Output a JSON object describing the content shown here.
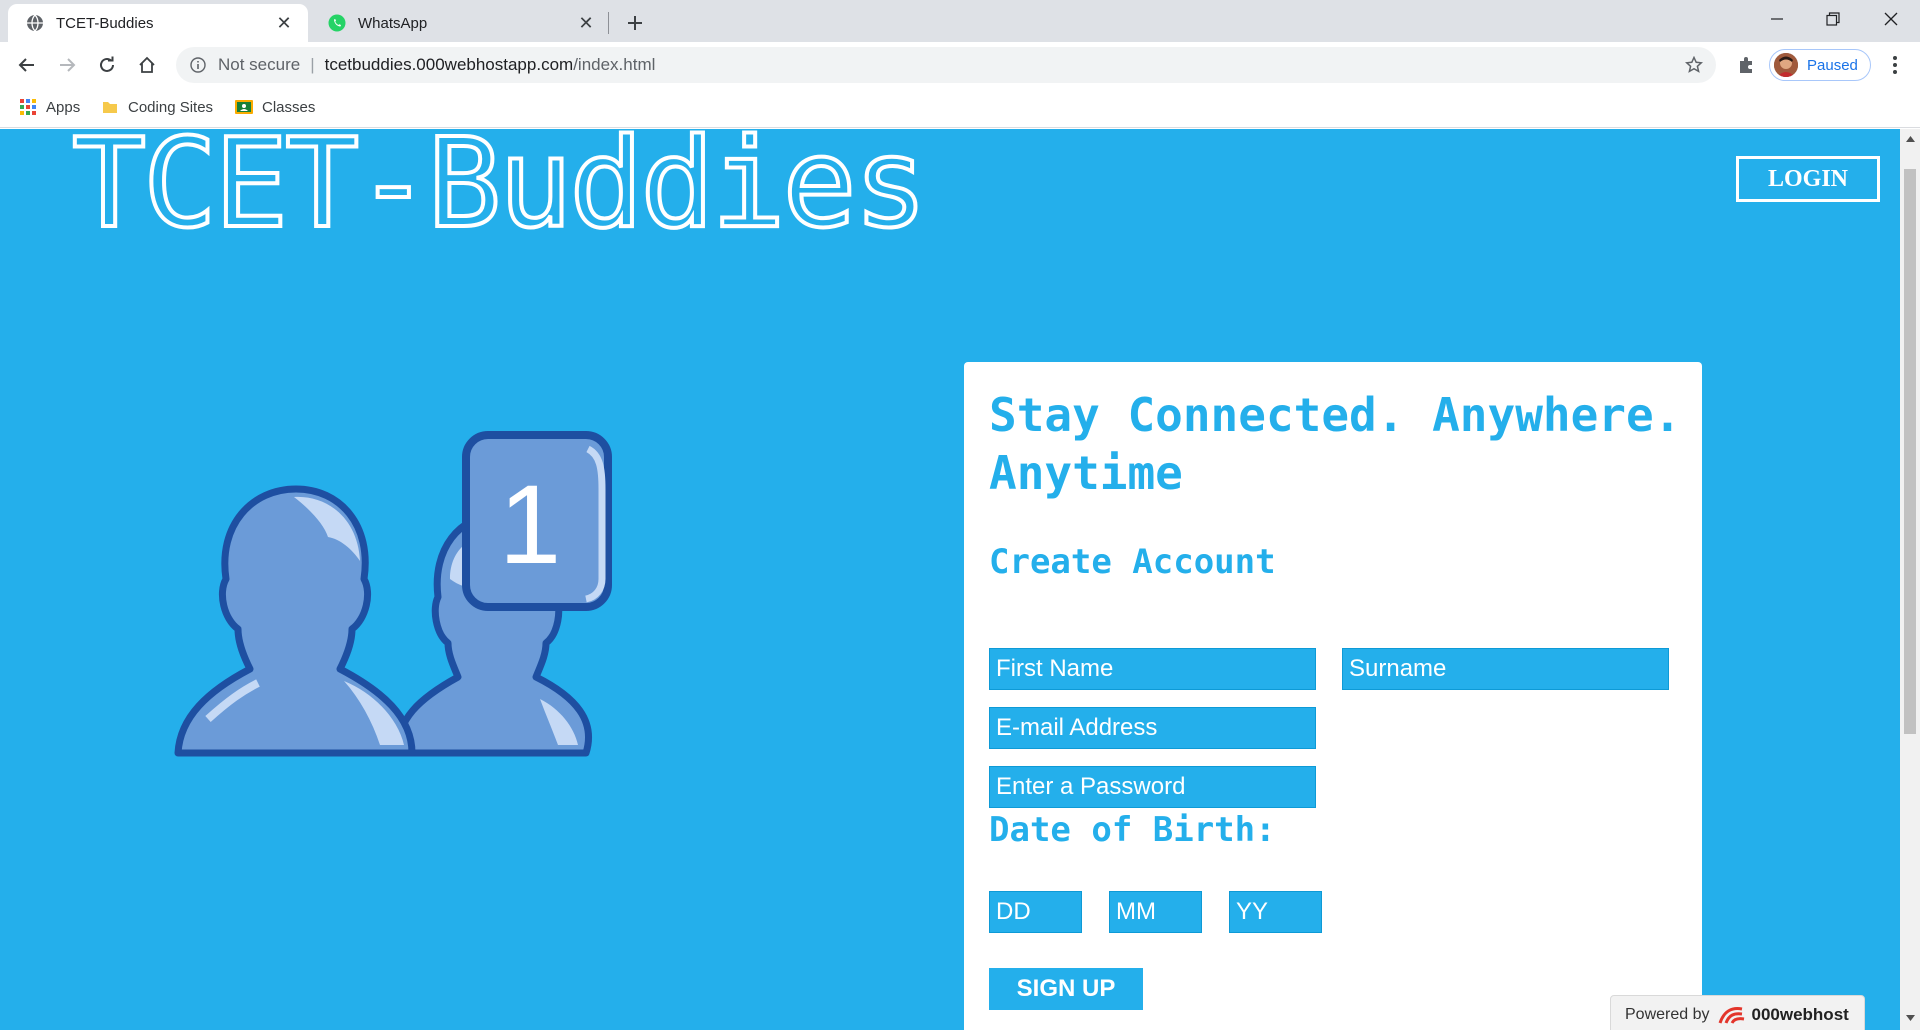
{
  "browser": {
    "tabs": [
      {
        "title": "TCET-Buddies",
        "icon": "globe-icon",
        "active": true
      },
      {
        "title": "WhatsApp",
        "icon": "whatsapp-icon",
        "active": false
      }
    ],
    "address": {
      "security_label": "Not secure",
      "separator": "|",
      "host": "tcetbuddies.000webhostapp.com",
      "path": "/index.html"
    },
    "profile": {
      "status": "Paused"
    },
    "bookmarks": [
      {
        "label": "Apps",
        "icon": "apps-grid-icon"
      },
      {
        "label": "Coding Sites",
        "icon": "folder-icon"
      },
      {
        "label": "Classes",
        "icon": "google-classroom-icon"
      }
    ]
  },
  "page": {
    "brand_title": "TCET-Buddies",
    "login_label": "LOGIN",
    "illustration": {
      "badge_number": "1",
      "icon": "friends-notification-icon"
    },
    "signup": {
      "tagline": "Stay Connected. Anywhere. Anytime",
      "heading": "Create Account",
      "first_name_placeholder": "First Name",
      "surname_placeholder": "Surname",
      "email_placeholder": "E-mail Address",
      "password_placeholder": "Enter a Password",
      "dob_label": "Date of Birth:",
      "dob_day_placeholder": "DD",
      "dob_month_placeholder": "MM",
      "dob_year_placeholder": "YY",
      "submit_label": "SIGN UP"
    },
    "host_badge": {
      "prefix": "Powered by",
      "brand": "000webhost"
    }
  },
  "colors": {
    "page_background": "#24afeb",
    "card_background": "#ffffff",
    "accent_text": "#24afeb",
    "illustration_fill": "#6b9bd8",
    "illustration_stroke": "#1e4fa1",
    "illustration_highlight": "#c5d9f5"
  }
}
